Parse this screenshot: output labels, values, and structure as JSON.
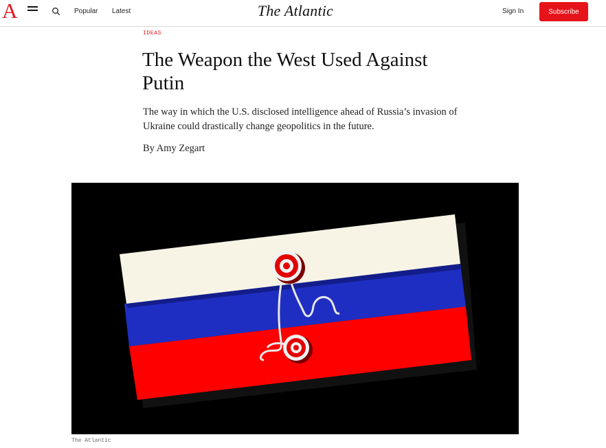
{
  "header": {
    "logo_letter": "A",
    "brand": "The Atlantic",
    "nav": {
      "popular": "Popular",
      "latest": "Latest"
    },
    "sign_in": "Sign In",
    "subscribe": "Subscribe"
  },
  "article": {
    "section": "IDEAS",
    "headline": "The Weapon the West Used Against Putin",
    "dek": "The way in which the U.S. disclosed intelligence ahead of Russia’s invasion of Ukraine could drastically change geopolitics in the future.",
    "byline_prefix": "By",
    "author": "Amy Zegart",
    "image_credit": "The Atlantic"
  },
  "colors": {
    "brand_red": "#e7131a",
    "flag_white": "#f7f4e6",
    "flag_blue": "#1f2ec2",
    "flag_red": "#ff0000"
  },
  "icons": [
    "menu-icon",
    "search-icon"
  ]
}
